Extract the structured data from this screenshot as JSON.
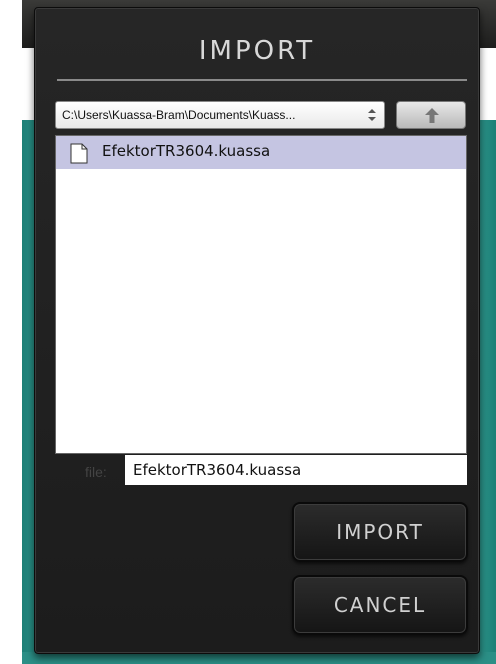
{
  "dialog": {
    "title": "IMPORT",
    "path_value": "C:\\Users\\Kuassa-Bram\\Documents\\Kuass...",
    "files": [
      {
        "name": "EfektorTR3604.kuassa",
        "selected": true
      }
    ],
    "file_label": "file:",
    "file_value": "EfektorTR3604.kuassa",
    "import_label": "IMPORT",
    "cancel_label": "CANCEL"
  },
  "icons": {
    "up": "up-arrow-icon",
    "select": "select-updown-icon",
    "file": "document-icon"
  },
  "colors": {
    "selection": "#c5c5e2",
    "dialog_bg": "#222222",
    "teal": "#46b8ad",
    "accent": "#e7df9a"
  }
}
